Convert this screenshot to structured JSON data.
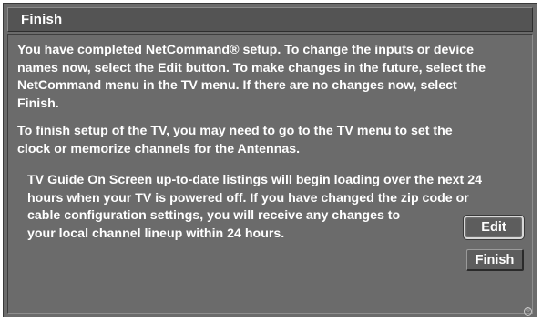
{
  "window": {
    "title": "Finish"
  },
  "content": {
    "paragraph_1": "You have completed NetCommand® setup.  To change the inputs or device\nnames now, select the Edit button.  To make changes in the future, select the\nNetCommand menu in the TV menu.  If there are no changes now, select\nFinish.",
    "paragraph_2": "To finish setup of the TV, you may need to go to the TV menu to set the\nclock or memorize channels for the Antennas.",
    "paragraph_3": "TV Guide On Screen up-to-date listings will begin loading over the next 24\nhours when your TV is powered off.  If you have changed the zip code or\ncable configuration settings, you will receive any changes to\nyour local channel lineup within 24 hours."
  },
  "buttons": {
    "edit_label": "Edit",
    "finish_label": "Finish"
  },
  "icons": {
    "corner": "registered-mark-icon"
  },
  "colors": {
    "background": "#6b6b6b",
    "title_bar": "#545454",
    "text": "#ffffff",
    "focus_outline": "#d8d8d8"
  }
}
